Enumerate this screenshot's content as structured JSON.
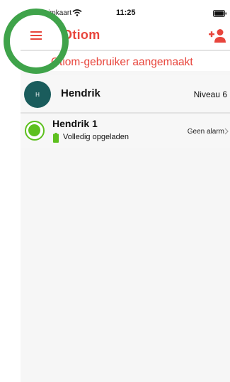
{
  "status_bar": {
    "carrier": "Geen simkaart",
    "time": "11:25"
  },
  "nav": {
    "title": "Otiom",
    "menu_icon": "hamburger-menu-icon",
    "add_user_icon": "add-user-icon"
  },
  "toast": {
    "message": "Otiom-gebruiker aangemaakt"
  },
  "profile": {
    "avatar_initial": "H",
    "name": "Hendrik",
    "level": "Niveau 6"
  },
  "device": {
    "name": "Hendrik 1",
    "battery_status": "Volledig opgeladen",
    "alarm_status": "Geen alarm"
  },
  "colors": {
    "accent": "#e8453c",
    "avatar": "#1a5c5c",
    "online": "#5dc01e",
    "highlight": "#3fa34a"
  }
}
